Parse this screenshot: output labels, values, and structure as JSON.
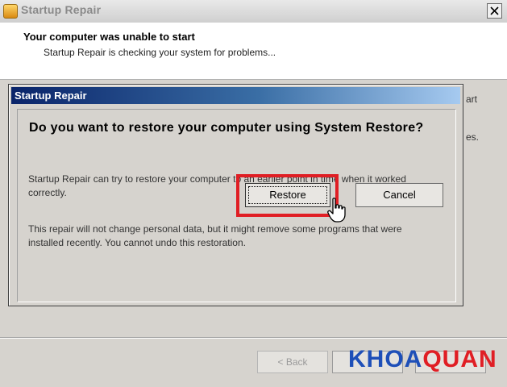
{
  "main_window": {
    "title": "Startup Repair",
    "header_title": "Your computer was unable to start",
    "header_subtitle": "Startup Repair is checking your system for problems...",
    "partial_text_1": "art",
    "partial_text_2": "es.",
    "back_label": "< Back",
    "next_label": "",
    "cancel_label": ""
  },
  "dialog": {
    "title": "Startup Repair",
    "question": "Do you want to restore your computer using System Restore?",
    "paragraph_1": "Startup Repair can try to restore your computer to an earlier point in time when it worked correctly.",
    "paragraph_2": "This repair will not change personal data, but it might remove some programs that were installed recently. You cannot undo this restoration.",
    "restore_label": "Restore",
    "cancel_label": "Cancel"
  },
  "watermark": {
    "text_1": "KHOA",
    "text_2": "QUAN"
  },
  "colors": {
    "highlight": "#e01e24",
    "dialog_title_start": "#0a246a",
    "dialog_title_end": "#a6caf0",
    "watermark_blue": "#1e4fb8",
    "watermark_red": "#e01e24"
  }
}
